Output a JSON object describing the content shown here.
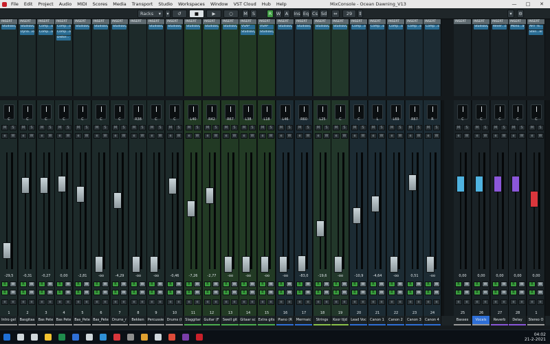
{
  "window": {
    "title": "MixConsole - Ocean Dawning_V13",
    "minimize": "—",
    "maximize": "□",
    "close": "✕"
  },
  "menu": [
    "File",
    "Edit",
    "Project",
    "Audio",
    "MIDI",
    "Scores",
    "Media",
    "Transport",
    "Studio",
    "Workspaces",
    "Window",
    "VST Cloud",
    "Hub",
    "Help"
  ],
  "toolbar": {
    "racks_label": "Racks",
    "racks_value": "▾",
    "ms": [
      "M",
      "S"
    ],
    "rw": [
      "R",
      "W",
      "A"
    ],
    "inserts": [
      "Ins",
      "Eq",
      "Cs",
      "Sd"
    ],
    "zoom_value": "29"
  },
  "rack_strips": [
    {
      "slots": [
        "StudioEQ"
      ]
    },
    {
      "slots": [
        "StudioEQ",
        "Dyna...ior"
      ]
    },
    {
      "slots": [
        "Comp...or",
        "Comp...or"
      ]
    },
    {
      "slots": [
        "Comp...or",
        "Comp...or",
        "Distor..."
      ]
    },
    {
      "slots": [
        "StudioEQ"
      ]
    },
    {
      "slots": [
        "StudioEQ"
      ]
    },
    {
      "slots": [
        "StudioEQ"
      ]
    },
    {
      "slots": []
    },
    {
      "slots": [
        "StudioEQ"
      ]
    },
    {
      "slots": [
        "StudioEQ"
      ]
    },
    {
      "slots": [
        "StudioEQ"
      ]
    },
    {
      "slots": [
        "StudioEQ"
      ]
    },
    {
      "slots": [
        "StudioEQ"
      ]
    },
    {
      "slots": [
        "VSAP",
        "StudioEQ"
      ]
    },
    {
      "slots": [
        "VSAP",
        "StudioEQ"
      ]
    },
    {
      "slots": [
        "StudioEQ"
      ]
    },
    {
      "slots": [
        "StudioEQ"
      ]
    },
    {
      "slots": [
        "StudioEQ"
      ]
    },
    {
      "slots": [
        "StudioEQ"
      ]
    },
    {
      "slots": [
        "Comp...or"
      ]
    },
    {
      "slots": [
        "Comp...or"
      ]
    },
    {
      "slots": [
        "Comp...or"
      ]
    },
    {
      "slots": [
        "Comp...or"
      ]
    },
    {
      "slots": [
        "Comp...or"
      ]
    },
    {
      "slots": []
    },
    {
      "slots": [
        "StudioEQ"
      ]
    },
    {
      "slots": [
        "Rever...ce"
      ]
    },
    {
      "slots": [
        "Mono...ay"
      ]
    },
    {
      "slots": [
        "ART TE...ee",
        "Sten...er"
      ]
    }
  ],
  "insert_header": "INSERT",
  "channels": [
    {
      "num": "1",
      "name": "Intro gel",
      "pan": "C",
      "vol": "-29,5",
      "fader": 0.16,
      "cap": "#c9d4d8",
      "bg": "#1d2a2a",
      "bar": "#999999"
    },
    {
      "num": "2",
      "name": "Basgitaa",
      "pan": "C",
      "vol": "-0,31",
      "fader": 0.72,
      "cap": "#c9d4d8",
      "bg": "#1d2a2a",
      "bar": "#999999"
    },
    {
      "num": "3",
      "name": "Bas Pete",
      "pan": "C",
      "vol": "-0,27",
      "fader": 0.72,
      "cap": "#c9d4d8",
      "bg": "#1d2a2a",
      "bar": "#999999"
    },
    {
      "num": "4",
      "name": "Bas Pete",
      "pan": "C",
      "vol": "0,00",
      "fader": 0.73,
      "cap": "#c9d4d8",
      "bg": "#1d2a2a",
      "bar": "#999999"
    },
    {
      "num": "5",
      "name": "Bas_Pete",
      "pan": "C",
      "vol": "-2,81",
      "fader": 0.64,
      "cap": "#c9d4d8",
      "bg": "#1d2a2a",
      "bar": "#999999"
    },
    {
      "num": "6",
      "name": "Bas_Pete",
      "pan": "C",
      "vol": "-oo",
      "fader": 0.04,
      "cap": "#c9d4d8",
      "bg": "#1d2a2a",
      "bar": "#999999"
    },
    {
      "num": "7",
      "name": "Drums_r",
      "pan": "C",
      "vol": "-4,29",
      "fader": 0.59,
      "cap": "#c9d4d8",
      "bg": "#1d2a2a",
      "bar": "#999999"
    },
    {
      "num": "8",
      "name": "Bekken",
      "pan": "R38",
      "vol": "-oo",
      "fader": 0.04,
      "cap": "#c9d4d8",
      "bg": "#1d2a2a",
      "bar": "#999999"
    },
    {
      "num": "9",
      "name": "Percussie",
      "pan": "C",
      "vol": "-oo",
      "fader": 0.04,
      "cap": "#c9d4d8",
      "bg": "#1d2a2a",
      "bar": "#999999"
    },
    {
      "num": "10",
      "name": "Drums (I",
      "pan": "C",
      "vol": "-0,46",
      "fader": 0.71,
      "cap": "#c9d4d8",
      "bg": "#1d2a2a",
      "bar": "#999999"
    },
    {
      "num": "11",
      "name": "Slaggitar",
      "pan": "L40",
      "vol": "-7,26",
      "fader": 0.52,
      "cap": "#c9d4d8",
      "bg": "#223a24",
      "bar": "#4caf50"
    },
    {
      "num": "12",
      "name": "Guitar (F",
      "pan": "R42",
      "vol": "-2,77",
      "fader": 0.63,
      "cap": "#c9d4d8",
      "bg": "#223a24",
      "bar": "#4caf50"
    },
    {
      "num": "13",
      "name": "Swell git",
      "pan": "R67",
      "vol": "-oo",
      "fader": 0.04,
      "cap": "#c9d4d8",
      "bg": "#223a24",
      "bar": "#4caf50"
    },
    {
      "num": "14",
      "name": "Gitaar sc",
      "pan": "L38",
      "vol": "-oo",
      "fader": 0.04,
      "cap": "#c9d4d8",
      "bg": "#223a24",
      "bar": "#4caf50"
    },
    {
      "num": "15",
      "name": "Extra gits",
      "pan": "L18",
      "vol": "-oo",
      "fader": 0.04,
      "cap": "#c9d4d8",
      "bg": "#223a24",
      "bar": "#4caf50"
    },
    {
      "num": "16",
      "name": "Piano (R",
      "pan": "L46",
      "vol": "-oo",
      "fader": 0.04,
      "cap": "#c9d4d8",
      "bg": "#1c2b33",
      "bar": "#2f6fd6"
    },
    {
      "num": "17",
      "name": "Mermaic",
      "pan": "R60",
      "vol": "-83,0",
      "fader": 0.05,
      "cap": "#c9d4d8",
      "bg": "#1c2b33",
      "bar": "#2f6fd6"
    },
    {
      "num": "18",
      "name": "Strings",
      "pan": "L25",
      "vol": "-19,6",
      "fader": 0.35,
      "cap": "#c9d4d8",
      "bg": "#22372a",
      "bar": "#8bc34a"
    },
    {
      "num": "19",
      "name": "Koor tijd",
      "pan": "C",
      "vol": "-oo",
      "fader": 0.04,
      "cap": "#c9d4d8",
      "bg": "#22372a",
      "bar": "#8bc34a"
    },
    {
      "num": "20",
      "name": "Lead Voc",
      "pan": "C",
      "vol": "-10,9",
      "fader": 0.46,
      "cap": "#c9d4d8",
      "bg": "#1c2b33",
      "bar": "#2f6fd6"
    },
    {
      "num": "21",
      "name": "Canon 1",
      "pan": "L",
      "vol": "-4,64",
      "fader": 0.56,
      "cap": "#c9d4d8",
      "bg": "#1c2b33",
      "bar": "#2f6fd6"
    },
    {
      "num": "22",
      "name": "Canon 2",
      "pan": "L69",
      "vol": "-oo",
      "fader": 0.04,
      "cap": "#c9d4d8",
      "bg": "#1c2b33",
      "bar": "#2f6fd6"
    },
    {
      "num": "23",
      "name": "Canon 3",
      "pan": "R67",
      "vol": "0,51",
      "fader": 0.74,
      "cap": "#c9d4d8",
      "bg": "#1c2b33",
      "bar": "#2f6fd6"
    },
    {
      "num": "24",
      "name": "Canon 4",
      "pan": "R",
      "vol": "-oo",
      "fader": 0.04,
      "cap": "#c9d4d8",
      "bg": "#1c2b33",
      "bar": "#2f6fd6"
    },
    {
      "num": "25",
      "name": "Basses",
      "pan": "C",
      "vol": "0,00",
      "fader": 0.73,
      "cap": "#4fb3e0",
      "bg": "#1a2226",
      "bar": "#999999"
    },
    {
      "num": "26",
      "name": "Vocals",
      "pan": "C",
      "vol": "0,00",
      "fader": 0.73,
      "cap": "#4fb3e0",
      "bg": "#1a2226",
      "bar": "#999999"
    },
    {
      "num": "27",
      "name": "Reverb",
      "pan": "C",
      "vol": "0,00",
      "fader": 0.73,
      "cap": "#8b57d9",
      "bg": "#1a2226",
      "bar": "#8b57d9"
    },
    {
      "num": "28",
      "name": "Delay",
      "pan": "C",
      "vol": "0,00",
      "fader": 0.73,
      "cap": "#8b57d9",
      "bg": "#1a2226",
      "bar": "#8b57d9"
    },
    {
      "num": "1",
      "name": "Stereo O",
      "pan": "C",
      "vol": "0,00",
      "fader": 0.6,
      "cap": "#d9363c",
      "bg": "#1a2226",
      "bar": "#999999"
    }
  ],
  "labels": {
    "m": "M",
    "s": "S",
    "r": "R",
    "w": "W",
    "e": "e"
  },
  "taskbar": {
    "time": "04:02",
    "date": "21-2-2021",
    "icons": [
      "start-icon",
      "search-icon",
      "task-view-icon",
      "explorer-icon",
      "excel-icon",
      "mail-icon",
      "store-icon",
      "edge-icon",
      "app-icon-1",
      "app-icon-2",
      "app-icon-3",
      "app-icon-4",
      "chrome-icon",
      "app-icon-5",
      "cubase-icon"
    ],
    "icon_colors": [
      "#1f6fd6",
      "#cfd6db",
      "#cfd6db",
      "#f2c230",
      "#1f8b4c",
      "#2f6fd6",
      "#cfd6db",
      "#2f8fd6",
      "#d9363c",
      "#8e8e8e",
      "#e0a030",
      "#cfd6db",
      "#dd4b39",
      "#7a3ea8",
      "#c8202a"
    ]
  }
}
